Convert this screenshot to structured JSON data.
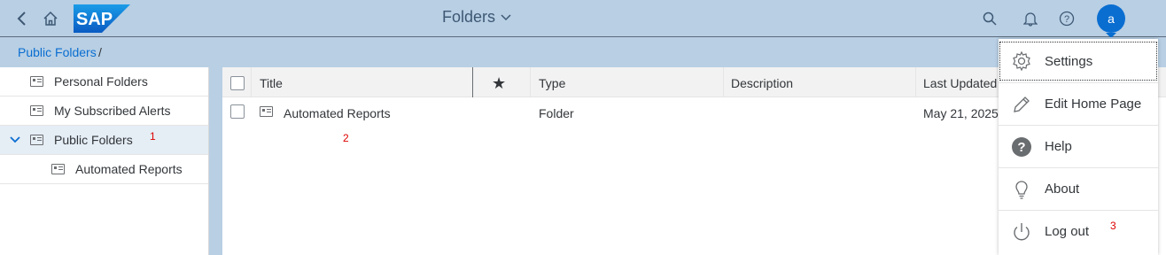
{
  "shell": {
    "title": "Folders",
    "logo_text": "SAP",
    "avatar_initial": "a"
  },
  "breadcrumb": {
    "link": "Public Folders",
    "separator": "/"
  },
  "tree": {
    "items": [
      {
        "label": "Personal Folders"
      },
      {
        "label": "My Subscribed Alerts"
      },
      {
        "label": "Public Folders"
      },
      {
        "label": "Automated Reports"
      }
    ]
  },
  "table": {
    "headers": {
      "title": "Title",
      "favorite": "★",
      "type": "Type",
      "description": "Description",
      "last_updated": "Last Updated"
    },
    "rows": [
      {
        "title": "Automated Reports",
        "type": "Folder",
        "description": "",
        "last_updated": "May 21, 2025"
      }
    ]
  },
  "annotations": {
    "one": "1",
    "two": "2",
    "three": "3"
  },
  "user_menu": {
    "items": [
      {
        "label": "Settings",
        "icon": "gear-icon"
      },
      {
        "label": "Edit Home Page",
        "icon": "pencil-icon"
      },
      {
        "label": "Help",
        "icon": "help-icon"
      },
      {
        "label": "About",
        "icon": "lightbulb-icon"
      },
      {
        "label": "Log out",
        "icon": "power-icon"
      }
    ]
  },
  "colors": {
    "shell_bg": "#b8cfe4",
    "accent": "#0a6ed1",
    "annotation": "#dd0000"
  }
}
